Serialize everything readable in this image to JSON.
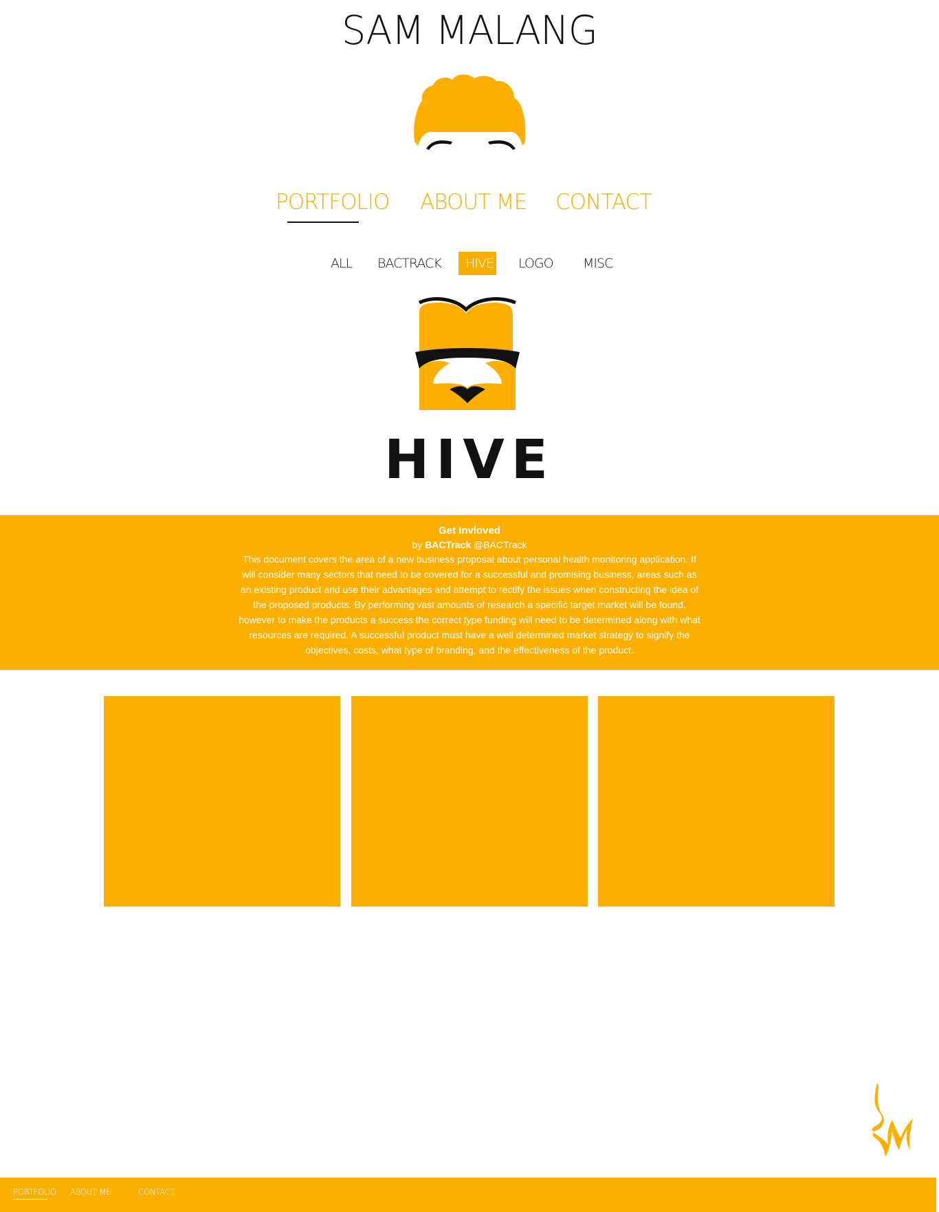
{
  "header": {
    "title": "SAM MALANG"
  },
  "main_nav": {
    "items": [
      {
        "label": "PORTFOLIO",
        "active": true
      },
      {
        "label": "ABOUT ME",
        "active": false
      },
      {
        "label": "CONTACT",
        "active": false
      }
    ]
  },
  "filters": {
    "items": [
      {
        "label": "ALL",
        "active": false
      },
      {
        "label": "BACTRACK",
        "active": false
      },
      {
        "label": "HIVE",
        "active": true
      },
      {
        "label": "LOGO",
        "active": false
      },
      {
        "label": "MISC",
        "active": false
      }
    ]
  },
  "project": {
    "wordmark": "HIVE",
    "title": "Get Invloved",
    "by_prefix": "by",
    "author": "BACTrack",
    "handle": "@BACTrack",
    "description": "This document covers the area of a new business proposal about personal health monitoring application. If will consider many sectors that need to be covered for a successful and promising business, areas such as an existing product and use their advantages and attempt to rectify the issues when constructing the idea of the proposed products. By performing vast amounts of research a specific target market will be found, however to make the products a success the correct type funding will need to be determined along with what resources are required. A successful product must have a well determined market strategy to signify the objectives, costs, what type of branding, and the effectiveness of the product."
  },
  "gallery": {
    "tile_count": 3
  },
  "footer": {
    "links": [
      {
        "label": "PORTFOLIO",
        "active": true
      },
      {
        "label": "ABOUT ME",
        "active": false
      },
      {
        "label": "CONTACT",
        "active": false
      }
    ]
  },
  "colors": {
    "accent": "#fcaf00",
    "text": "#111111",
    "background": "#ffffff"
  },
  "icons": {
    "avatar": "hair-avatar-icon",
    "hive_logo": "hive-bee-logo-icon",
    "signature": "sm-signature-monogram-icon"
  }
}
